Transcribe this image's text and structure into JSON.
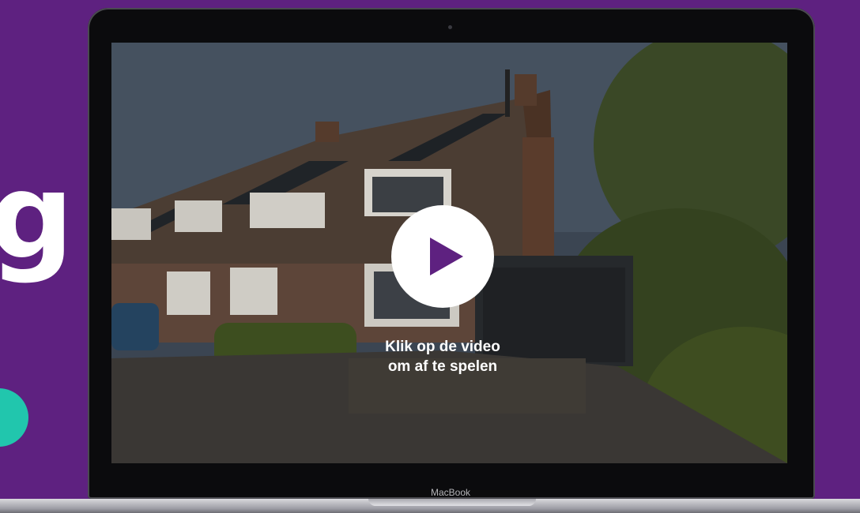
{
  "video": {
    "caption_line1": "Klik op de video",
    "caption_line2": "om af te spelen"
  },
  "laptop": {
    "brand_label": "MacBook"
  },
  "colors": {
    "background": "#5e2180",
    "play_icon": "#5e2180",
    "accent_dot": "#21c6ad"
  },
  "icons": {
    "play": "play-icon",
    "camera": "camera-icon"
  }
}
